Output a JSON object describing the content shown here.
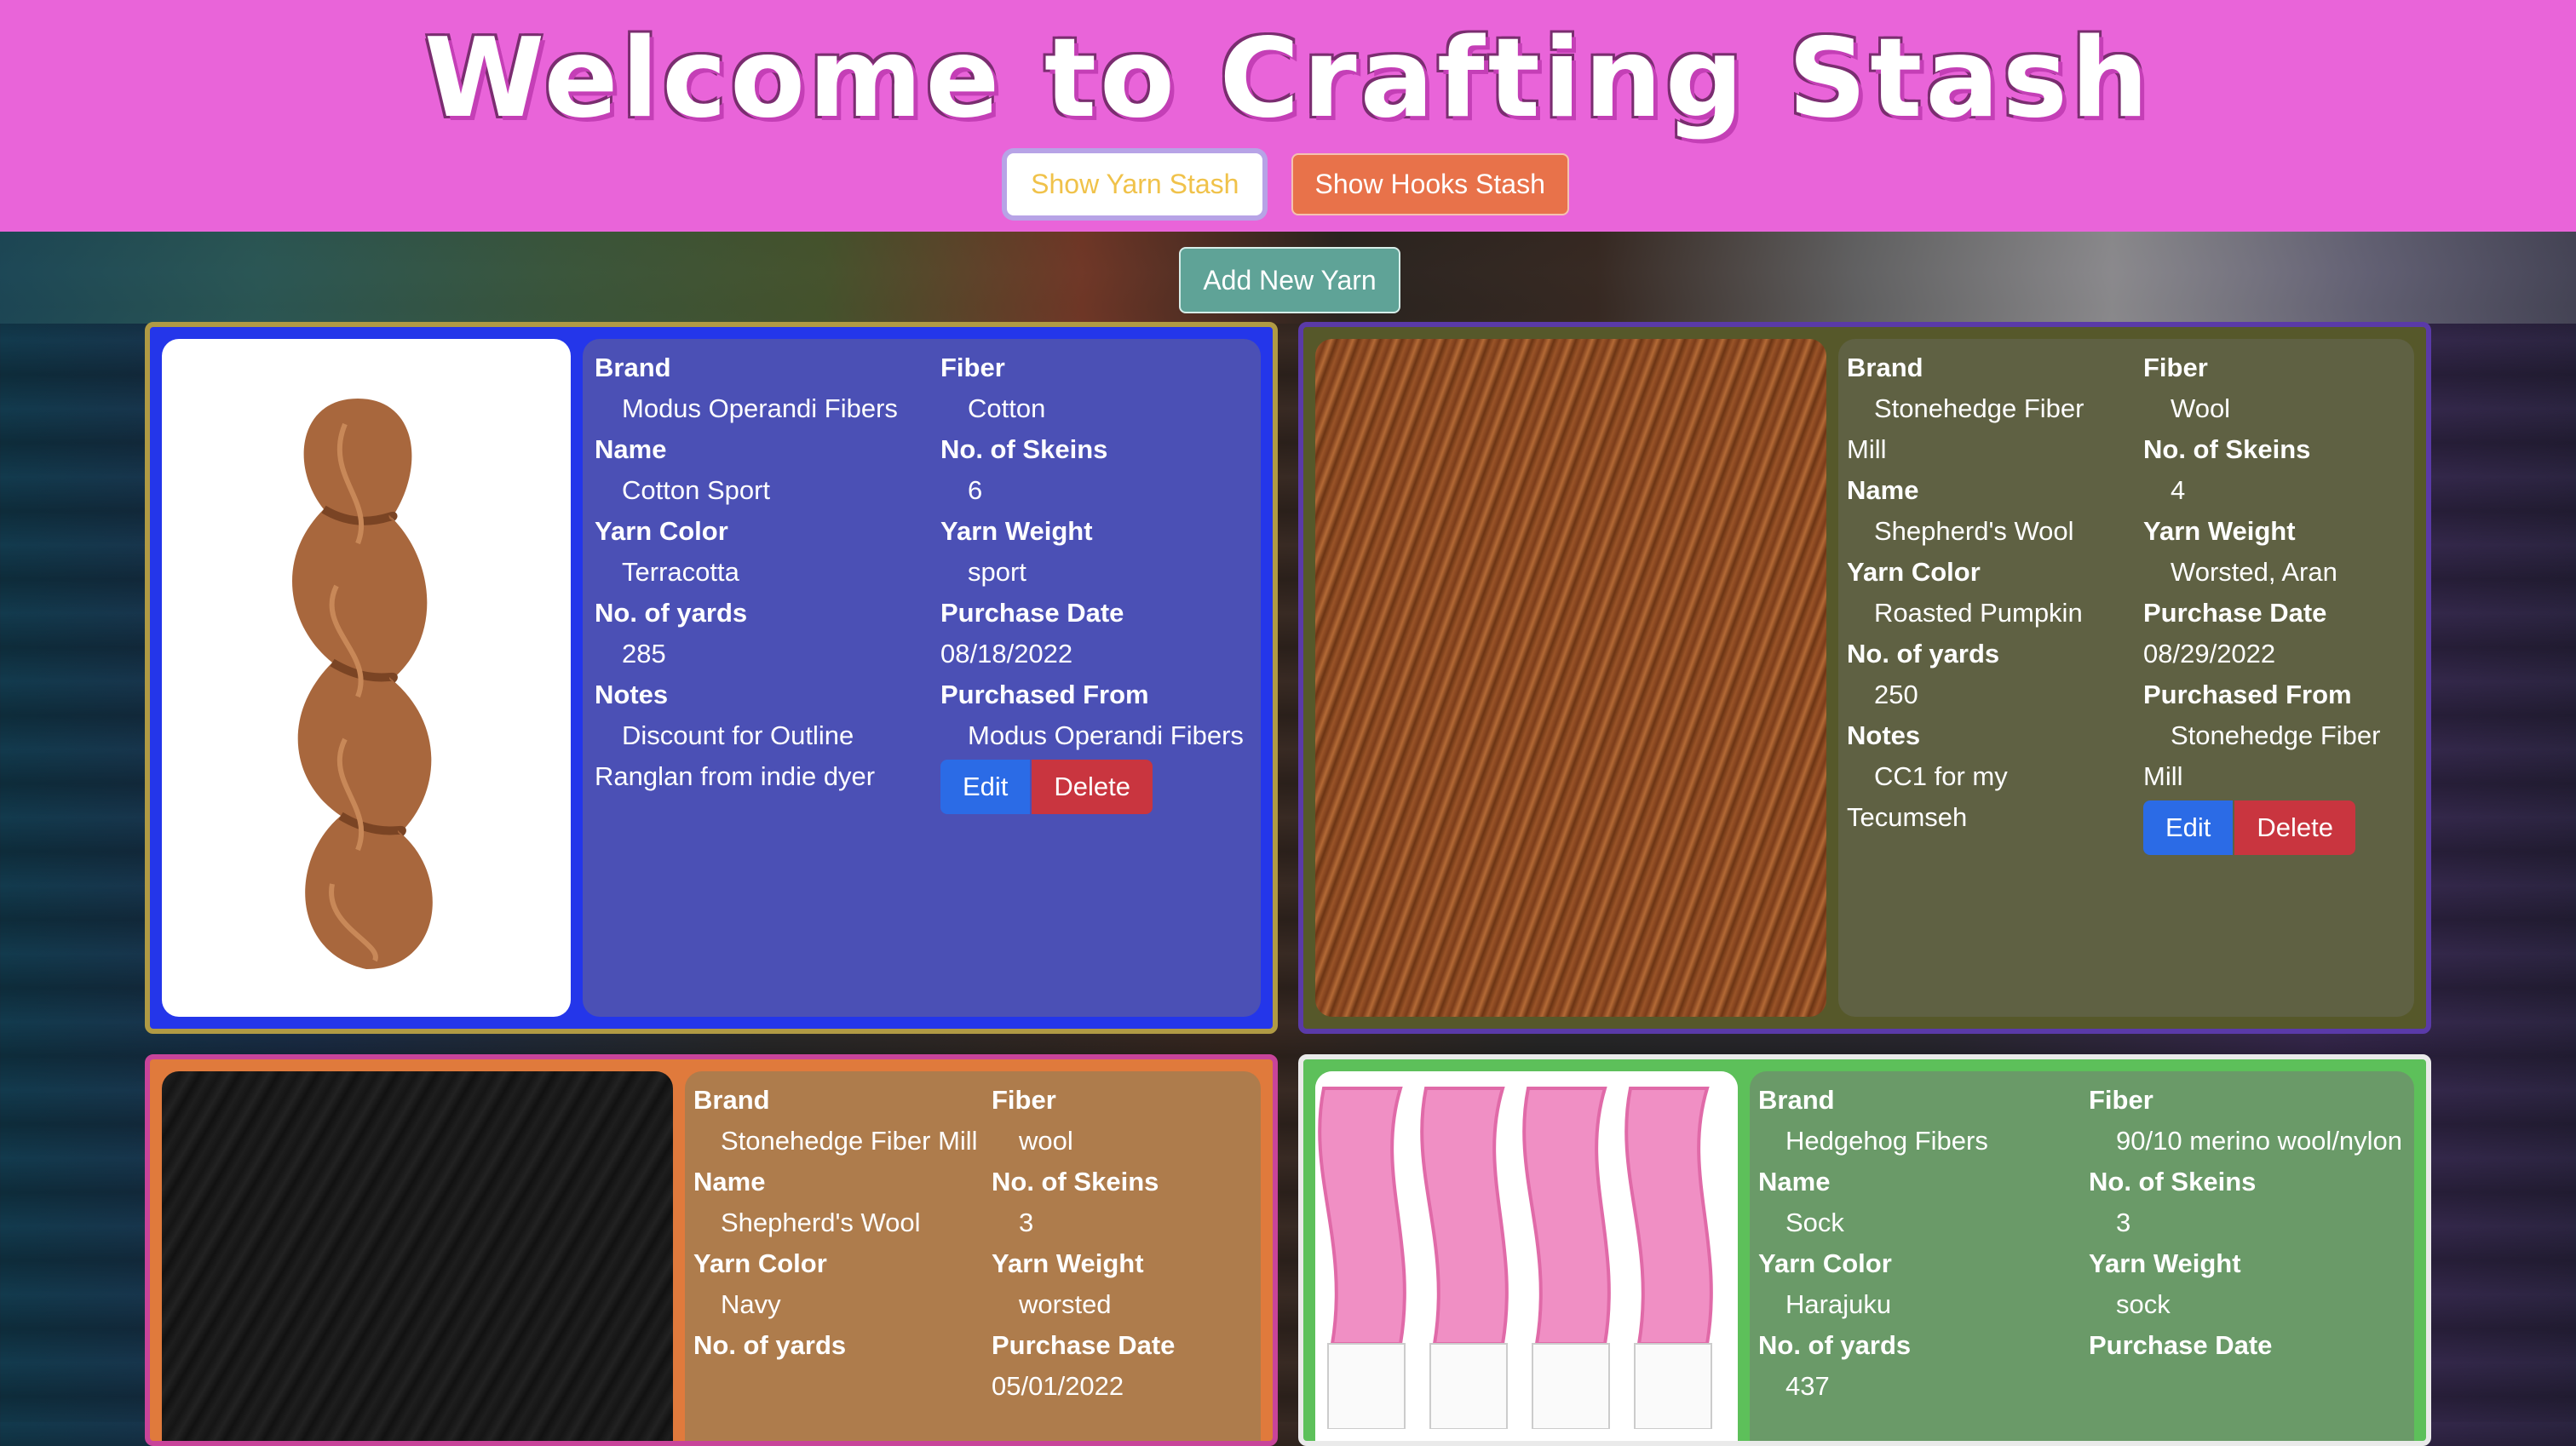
{
  "header": {
    "title": "Welcome to Crafting Stash",
    "tabs": [
      "Show Yarn Stash",
      "Show Hooks Stash"
    ],
    "bg_color": "#e964d9"
  },
  "add_button": "Add New Yarn",
  "labels": {
    "brand": "Brand",
    "name": "Name",
    "color": "Yarn Color",
    "yards": "No. of yards",
    "notes": "Notes",
    "fiber": "Fiber",
    "skeins": "No. of Skeins",
    "weight": "Yarn Weight",
    "date": "Purchase Date",
    "from": "Purchased From",
    "edit": "Edit",
    "delete": "Delete"
  },
  "cards": [
    {
      "brand": "Modus Operandi Fibers",
      "name": "Cotton Sport",
      "color": "Terracotta",
      "yards": "285",
      "notes": "Discount for Outline Ranglan from indie dyer",
      "fiber": "Cotton",
      "skeins": "6",
      "weight": "sport",
      "date": "08/18/2022",
      "from": "Modus Operandi Fibers"
    },
    {
      "brand": "Stonehedge Fiber Mill",
      "name": "Shepherd's Wool",
      "color": "Roasted Pumpkin",
      "yards": "250",
      "notes": "CC1 for my Tecumseh",
      "fiber": "Wool",
      "skeins": "4",
      "weight": "Worsted, Aran",
      "date": "08/29/2022",
      "from": "Stonehedge Fiber Mill"
    },
    {
      "brand": "Stonehedge Fiber Mill",
      "name": "Shepherd's Wool",
      "color": "Navy",
      "yards": "",
      "fiber": "wool",
      "skeins": "3",
      "weight": "worsted",
      "date": "05/01/2022"
    },
    {
      "brand": "Hedgehog Fibers",
      "name": "Sock",
      "color": "Harajuku",
      "yards": "437",
      "fiber": "90/10 merino wool/nylon",
      "skeins": "3",
      "weight": "sock"
    }
  ]
}
